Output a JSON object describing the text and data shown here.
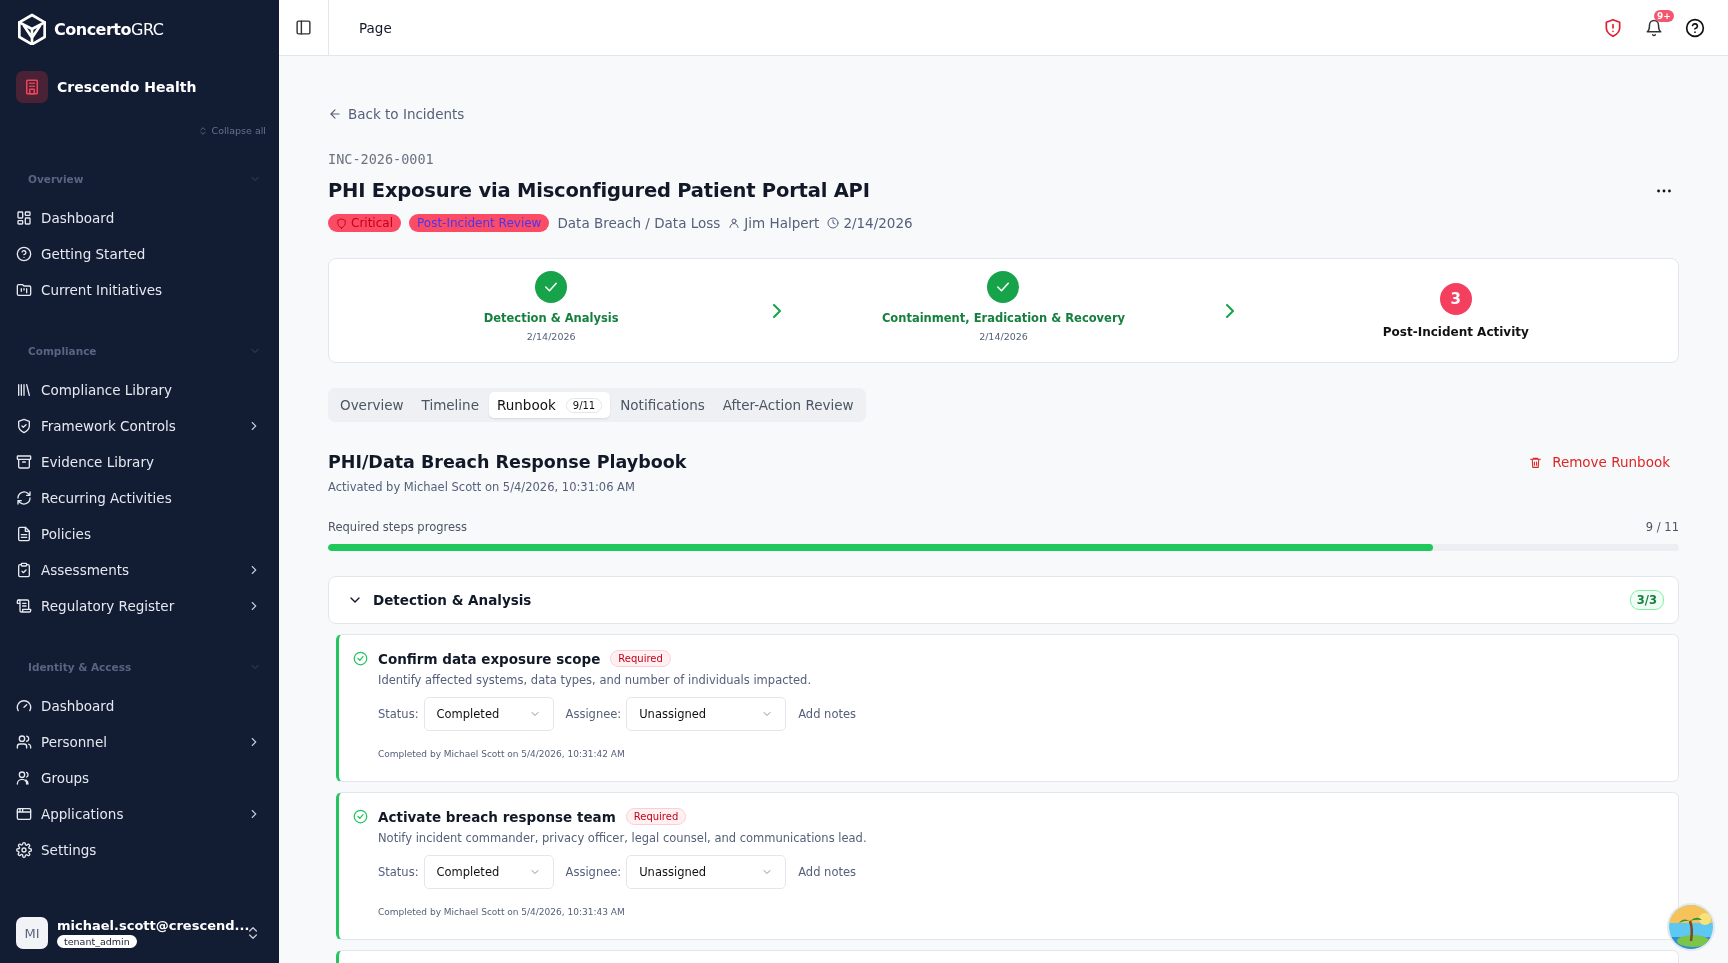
{
  "brand": {
    "name": "Concerto",
    "suffix": "GRC"
  },
  "organization": {
    "name": "Crescendo Health"
  },
  "collapse_all": "Collapse all",
  "nav_sections": [
    {
      "title": "Overview",
      "expanded": true,
      "items": [
        {
          "label": "Dashboard",
          "submenu": false
        },
        {
          "label": "Getting Started",
          "submenu": false
        },
        {
          "label": "Current Initiatives",
          "submenu": false
        }
      ]
    },
    {
      "title": "Compliance",
      "expanded": true,
      "items": [
        {
          "label": "Compliance Library",
          "submenu": false
        },
        {
          "label": "Framework Controls",
          "submenu": true
        },
        {
          "label": "Evidence Library",
          "submenu": false
        },
        {
          "label": "Recurring Activities",
          "submenu": false
        },
        {
          "label": "Policies",
          "submenu": false
        },
        {
          "label": "Assessments",
          "submenu": true
        },
        {
          "label": "Regulatory Register",
          "submenu": true
        }
      ]
    },
    {
      "title": "Identity & Access",
      "expanded": true,
      "items": [
        {
          "label": "Dashboard",
          "submenu": false
        },
        {
          "label": "Personnel",
          "submenu": true
        },
        {
          "label": "Groups",
          "submenu": false
        },
        {
          "label": "Applications",
          "submenu": true
        },
        {
          "label": "Settings",
          "submenu": false
        }
      ]
    }
  ],
  "user": {
    "initials": "MI",
    "email": "michael.scott@crescend...",
    "role": "tenant_admin"
  },
  "header": {
    "title": "Page",
    "notification_count": "9+"
  },
  "back_link": "Back to Incidents",
  "incident": {
    "id": "INC-2026-0001",
    "title": "PHI Exposure via Misconfigured Patient Portal API",
    "severity": "Critical",
    "status": "Post-Incident Review",
    "category": "Data Breach / Data Loss",
    "owner": "Jim Halpert",
    "date": "2/14/2026"
  },
  "phases": [
    {
      "name": "Detection & Analysis",
      "date": "2/14/2026",
      "completed": true
    },
    {
      "name": "Containment, Eradication & Recovery",
      "date": "2/14/2026",
      "completed": true
    },
    {
      "name": "Post-Incident Activity",
      "number": "3",
      "completed": false
    }
  ],
  "tabs": [
    {
      "label": "Overview",
      "selected": false
    },
    {
      "label": "Timeline",
      "selected": false
    },
    {
      "label": "Runbook",
      "count": "9/11",
      "selected": true
    },
    {
      "label": "Notifications",
      "selected": false
    },
    {
      "label": "After-Action Review",
      "selected": false
    }
  ],
  "runbook": {
    "title": "PHI/Data Breach Response Playbook",
    "activated": "Activated by Michael Scott on 5/4/2026, 10:31:06 AM",
    "remove_label": "Remove Runbook",
    "progress_label": "Required steps progress",
    "progress_text": "9 / 11",
    "level": 0.818
  },
  "sections": [
    {
      "title": "Detection & Analysis",
      "count": "3/3",
      "expanded": true,
      "steps": [
        {
          "title": "Confirm data exposure scope",
          "required": "Required",
          "description": "Identify affected systems, data types, and number of individuals impacted.",
          "status_label": "Status:",
          "status": "Completed",
          "assignee_label": "Assignee:",
          "assignee": "Unassigned",
          "notes_label": "Add notes",
          "completed_note": "Completed by Michael Scott on 5/4/2026, 10:31:42 AM",
          "completed": true
        },
        {
          "title": "Activate breach response team",
          "required": "Required",
          "description": "Notify incident commander, privacy officer, legal counsel, and communications lead.",
          "status_label": "Status:",
          "status": "Completed",
          "assignee_label": "Assignee:",
          "assignee": "Unassigned",
          "notes_label": "Add notes",
          "completed_note": "Completed by Michael Scott on 5/4/2026, 10:31:43 AM",
          "completed": true
        }
      ]
    }
  ]
}
